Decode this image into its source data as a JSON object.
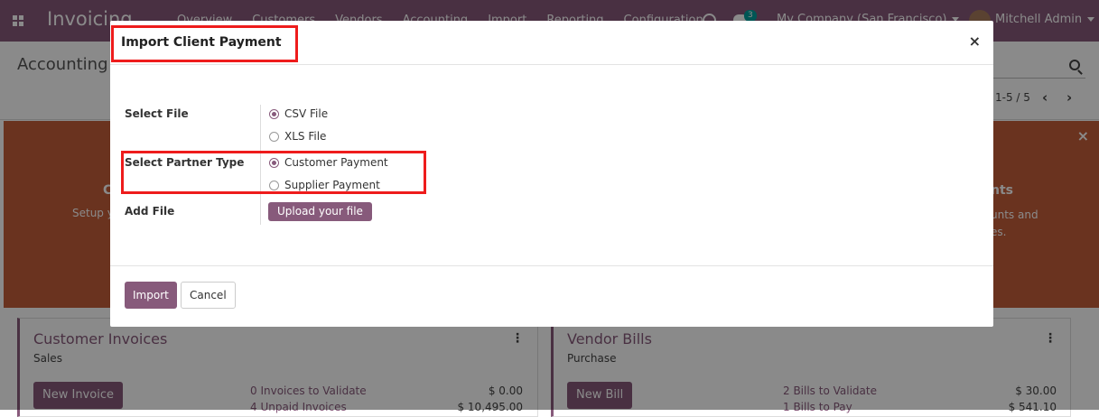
{
  "app": {
    "brand": "Invoicing",
    "menu": [
      "Overview",
      "Customers",
      "Vendors",
      "Accounting",
      "Import",
      "Reporting",
      "Configuration"
    ],
    "notification_count": "3",
    "company": "My Company (San Francisco)",
    "user": "Mitchell Admin"
  },
  "control_panel": {
    "breadcrumb": "Accounting C",
    "pager": "1-5 / 5"
  },
  "banner": {
    "left_title": "C",
    "left_text": "Setup y",
    "right_title": "nts",
    "right_text_line1": "unts and",
    "right_text_line2": "es."
  },
  "dashboard": {
    "customer": {
      "title": "Customer Invoices",
      "subtitle": "Sales",
      "button": "New Invoice",
      "stats": [
        {
          "label": "0 Invoices to Validate",
          "value": "$ 0.00"
        },
        {
          "label": "4 Unpaid Invoices",
          "value": "$ 10,495.00"
        }
      ]
    },
    "vendor": {
      "title": "Vendor Bills",
      "subtitle": "Purchase",
      "button": "New Bill",
      "stats": [
        {
          "label": "2 Bills to Validate",
          "value": "$ 30.00"
        },
        {
          "label": "1 Bills to Pay",
          "value": "$ 541.10"
        }
      ]
    }
  },
  "modal": {
    "title": "Import Client Payment",
    "select_file_label": "Select File",
    "file_options": [
      {
        "label": "CSV File",
        "checked": true
      },
      {
        "label": "XLS File",
        "checked": false
      }
    ],
    "partner_type_label": "Select Partner Type",
    "partner_options": [
      {
        "label": "Customer Payment",
        "checked": true
      },
      {
        "label": "Supplier Payment",
        "checked": false
      }
    ],
    "add_file_label": "Add File",
    "upload_button": "Upload your file",
    "import_button": "Import",
    "cancel_button": "Cancel"
  },
  "colors": {
    "primary": "#875a7b",
    "banner": "#c45e3a",
    "highlight": "#ee1c1c"
  }
}
